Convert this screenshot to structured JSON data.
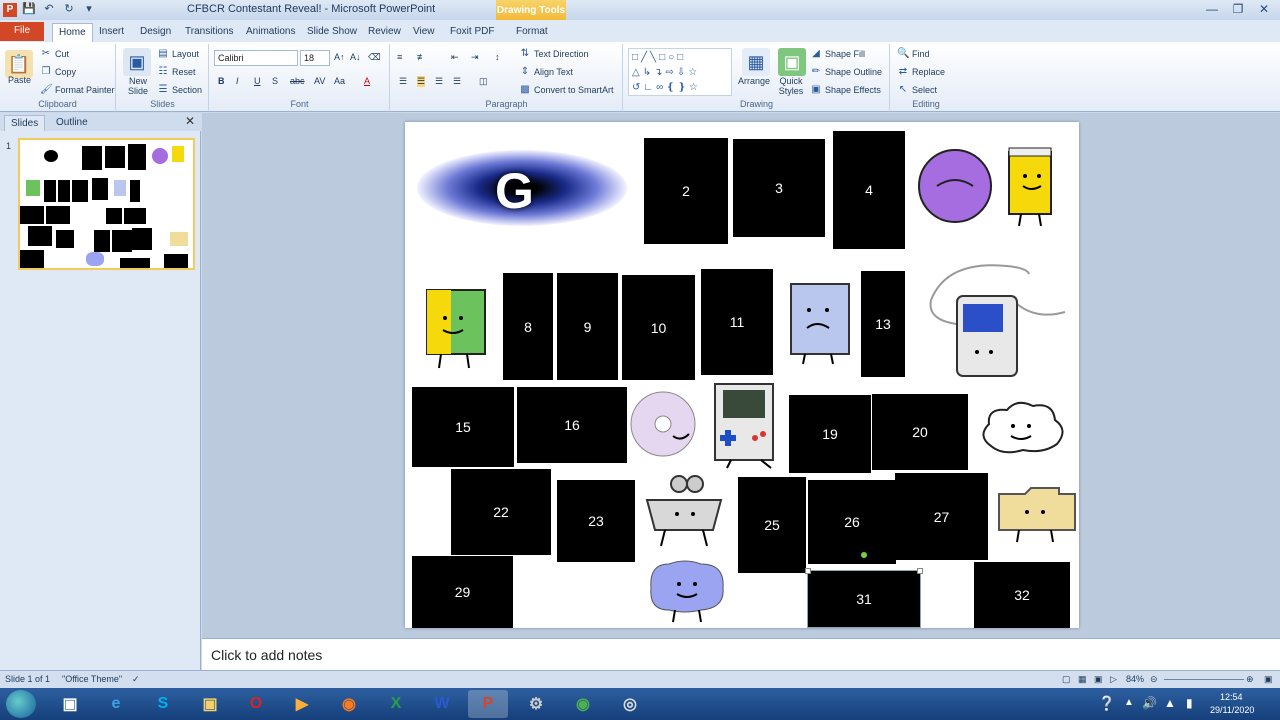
{
  "window": {
    "app_letter": "P",
    "title": "CFBCR Contestant Reveal! - Microsoft PowerPoint",
    "contextual_tab": "Drawing Tools"
  },
  "tabs": [
    "File",
    "Home",
    "Insert",
    "Design",
    "Transitions",
    "Animations",
    "Slide Show",
    "Review",
    "View",
    "Foxit PDF",
    "Format"
  ],
  "ribbon": {
    "clipboard": {
      "label": "Clipboard",
      "paste": "Paste",
      "cut": "Cut",
      "copy": "Copy",
      "format_painter": "Format Painter"
    },
    "slides": {
      "label": "Slides",
      "new_slide": "New Slide",
      "layout": "Layout",
      "reset": "Reset",
      "section": "Section"
    },
    "font": {
      "label": "Font",
      "family": "Calibri",
      "size": "18"
    },
    "paragraph": {
      "label": "Paragraph",
      "text_direction": "Text Direction",
      "align_text": "Align Text",
      "smartart": "Convert to SmartArt"
    },
    "drawing": {
      "label": "Drawing",
      "arrange": "Arrange",
      "quick_styles": "Quick Styles",
      "shape_fill": "Shape Fill",
      "shape_outline": "Shape Outline",
      "shape_effects": "Shape Effects"
    },
    "editing": {
      "label": "Editing",
      "find": "Find",
      "replace": "Replace",
      "select": "Select"
    }
  },
  "pane": {
    "tab_slides": "Slides",
    "tab_outline": "Outline",
    "slide_number": "1"
  },
  "slide": {
    "logo_letter": "G",
    "boxes": [
      "2",
      "3",
      "4",
      "8",
      "9",
      "10",
      "11",
      "13",
      "15",
      "16",
      "19",
      "20",
      "22",
      "23",
      "25",
      "26",
      "27",
      "29",
      "31",
      "32"
    ]
  },
  "notes_placeholder": "Click to add notes",
  "status": {
    "slide": "Slide 1 of 1",
    "theme": "\"Office Theme\"",
    "zoom": "84%"
  },
  "taskbar": {
    "apps": [
      "S",
      "X",
      "W",
      "P"
    ],
    "time": "12:54",
    "date": "29/11/2020"
  }
}
